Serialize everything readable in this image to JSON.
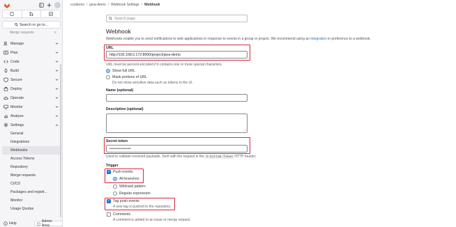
{
  "sidebar": {
    "search_label": "Search or go to...",
    "faded_item": "Merge requests",
    "faded_count": "0",
    "sections": [
      {
        "label": "Manage",
        "icon": "users-icon"
      },
      {
        "label": "Plan",
        "icon": "plan-icon"
      },
      {
        "label": "Code",
        "icon": "code-icon"
      },
      {
        "label": "Build",
        "icon": "rocket-icon"
      },
      {
        "label": "Secure",
        "icon": "shield-icon"
      },
      {
        "label": "Deploy",
        "icon": "deploy-icon"
      },
      {
        "label": "Operate",
        "icon": "cloud-icon"
      },
      {
        "label": "Monitor",
        "icon": "monitor-icon"
      },
      {
        "label": "Analyze",
        "icon": "chart-icon"
      },
      {
        "label": "Settings",
        "icon": "gear-icon"
      }
    ],
    "settings_items": [
      "General",
      "Integrations",
      "Webhooks",
      "Access Tokens",
      "Repository",
      "Merge requests",
      "CI/CD",
      "Packages and registr...",
      "Monitor",
      "Usage Quotas"
    ],
    "help_label": "Help",
    "admin_label": "Admin Area"
  },
  "breadcrumb": [
    "ccsdemo",
    "java-demo",
    "Webhook Settings",
    "Webhook"
  ],
  "search_placeholder": "Search page",
  "page": {
    "title": "Webhook",
    "desc_before": "Webhooks enable you to send notifications to web applications in response to events in a group or project. We recommend using an ",
    "desc_link": "integration",
    "desc_after": " in preference to a webhook."
  },
  "form": {
    "url_label": "URL",
    "url_value": "http://192.168.0.172:8000/project/java-demo",
    "url_help": "URL must be percent-encoded if it contains one or more special characters.",
    "show_full_url": "Show full URL",
    "mask_url": "Mask portions of URL",
    "mask_help": "Do not show sensitive data such as tokens in the UI.",
    "name_label": "Name (optional)",
    "desc_label": "Description (optional)",
    "secret_label": "Secret token",
    "secret_value": "••••••••••••••",
    "secret_help_before": "Used to validate received payloads. Sent with the request in the ",
    "secret_help_code": "X-Gitlab-Token",
    "secret_help_after": " HTTP header.",
    "trigger_label": "Trigger",
    "push_events": "Push events",
    "all_branches": "All branches",
    "wildcard": "Wildcard pattern",
    "regex": "Regular expression",
    "tag_push": "Tag push events",
    "tag_push_help": "A new tag is pushed to the repository.",
    "comments": "Comments",
    "comments_help": "A comment is added to an issue or merge request."
  }
}
